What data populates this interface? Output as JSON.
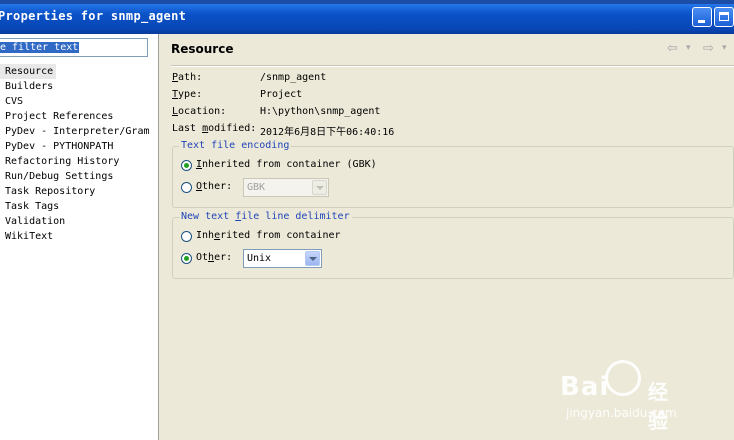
{
  "window": {
    "title": "Properties for snmp_agent"
  },
  "filter": {
    "text": "e filter text"
  },
  "tree": [
    "Resource",
    "Builders",
    "CVS",
    "Project References",
    "PyDev - Interpreter/Gram",
    "PyDev - PYTHONPATH",
    "Refactoring History",
    "Run/Debug Settings",
    "Task Repository",
    "Task Tags",
    "Validation",
    "WikiText"
  ],
  "page": {
    "title": "Resource",
    "back_icon": "⇦",
    "back_dropdown": "▾",
    "fwd_icon": "⇨",
    "fwd_dropdown": "▾"
  },
  "info": {
    "path_label_u": "P",
    "path_label_rest": "ath:",
    "path_value": "/snmp_agent",
    "type_label_u": "T",
    "type_label_rest": "ype:",
    "type_value": "Project",
    "loc_label_pre": "",
    "loc_label_u": "L",
    "loc_label_rest": "ocation:",
    "loc_value": "H:\\python\\snmp_agent",
    "mod_label_pre": "Last ",
    "mod_label_u": "m",
    "mod_label_rest": "odified:",
    "mod_value": "2012年6月8日下午06:40:16"
  },
  "encoding": {
    "title": "Text file encoding",
    "inherited_u": "I",
    "inherited_rest": "nherited from container (GBK)",
    "other_u": "O",
    "other_rest": "ther:",
    "other_value": "GBK"
  },
  "delimiter": {
    "title_pre": "New text ",
    "title_u": "f",
    "title_rest": "ile line delimiter",
    "inherited_pre": "Inh",
    "inherited_u": "e",
    "inherited_rest": "rited from container",
    "other_pre": "Ot",
    "other_u": "h",
    "other_rest": "er:",
    "other_value": "Unix"
  },
  "watermark": {
    "brand_left": "Bai",
    "brand_right": "经验",
    "url": "jingyan.baidu.com"
  },
  "colors": {
    "title_bar": "#0b53c9",
    "group_title": "#1f45b8",
    "selection": "#316ac5",
    "dialog_bg": "#ece9d8"
  }
}
